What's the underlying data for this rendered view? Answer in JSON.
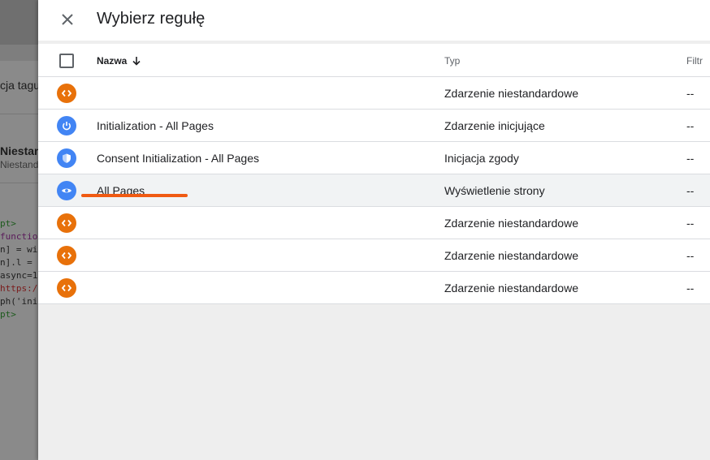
{
  "background": {
    "line1": "cja tagu",
    "line2": "Niestan",
    "line3": "Niestand",
    "code": [
      "pt>",
      "functio",
      "n] = wi",
      "n].l = ",
      "async=1",
      "https:/",
      "ph('ini",
      "pt>"
    ]
  },
  "dialog": {
    "title": "Wybierz regułę",
    "close_icon": "close-icon",
    "columns": {
      "name": "Nazwa",
      "type": "Typ",
      "filter": "Filtr"
    },
    "rows": [
      {
        "icon": "code-icon",
        "color": "#e8710a",
        "name": "",
        "type": "Zdarzenie niestandardowe",
        "filter": "--"
      },
      {
        "icon": "power-icon",
        "color": "#4285f4",
        "name": "Initialization - All Pages",
        "type": "Zdarzenie inicjujące",
        "filter": "--"
      },
      {
        "icon": "shield-icon",
        "color": "#4285f4",
        "name": "Consent Initialization - All Pages",
        "type": "Inicjacja zgody",
        "filter": "--"
      },
      {
        "icon": "eye-icon",
        "color": "#4285f4",
        "name": "All Pages",
        "type": "Wyświetlenie strony",
        "filter": "--"
      },
      {
        "icon": "code-icon",
        "color": "#e8710a",
        "name": "",
        "type": "Zdarzenie niestandardowe",
        "filter": "--"
      },
      {
        "icon": "code-icon",
        "color": "#e8710a",
        "name": "",
        "type": "Zdarzenie niestandardowe",
        "filter": "--"
      },
      {
        "icon": "code-icon",
        "color": "#e8710a",
        "name": "",
        "type": "Zdarzenie niestandardowe",
        "filter": "--"
      }
    ]
  },
  "colors": {
    "accent_underline": "#f05a12",
    "custom_event": "#e8710a",
    "builtin": "#4285f4"
  }
}
